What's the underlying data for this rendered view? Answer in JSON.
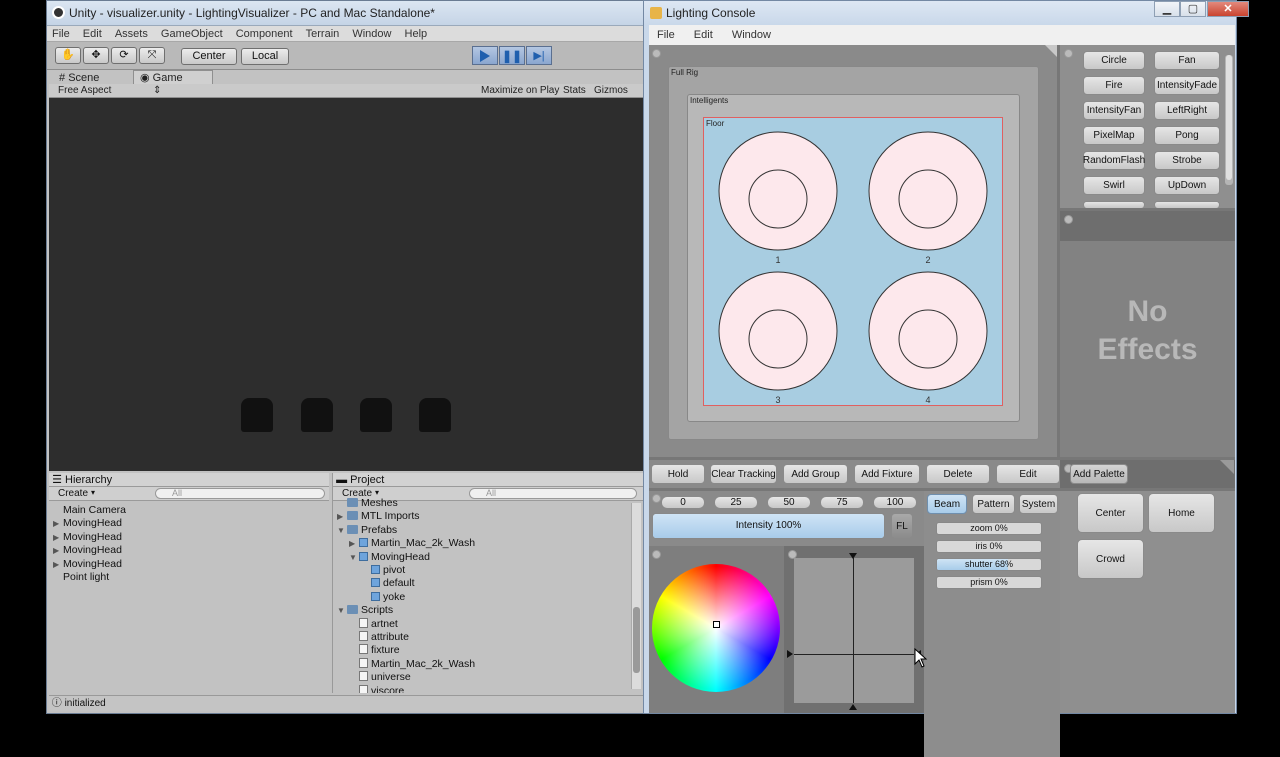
{
  "unity": {
    "window_title": "Unity - visualizer.unity - LightingVisualizer - PC and Mac Standalone*",
    "menu": [
      "File",
      "Edit",
      "Assets",
      "GameObject",
      "Component",
      "Terrain",
      "Window",
      "Help"
    ],
    "pivot_center": "Center",
    "pivot_local": "Local",
    "tabs": {
      "scene": "Scene",
      "game": "Game"
    },
    "gamebar": {
      "aspect": "Free Aspect",
      "maximize": "Maximize on Play",
      "stats": "Stats",
      "gizmos": "Gizmos"
    },
    "hierarchy": {
      "title": "Hierarchy",
      "create": "Create",
      "search_placeholder": "All",
      "items": [
        "Main Camera",
        "MovingHead",
        "MovingHead",
        "MovingHead",
        "MovingHead",
        "Point light"
      ]
    },
    "project": {
      "title": "Project",
      "create": "Create",
      "search_placeholder": "All",
      "items": [
        "Meshes",
        "MTL Imports",
        "Prefabs",
        "Martin_Mac_2k_Wash",
        "MovingHead",
        "pivot",
        "default",
        "yoke",
        "Scripts",
        "artnet",
        "attribute",
        "fixture",
        "Martin_Mac_2k_Wash",
        "universe",
        "viscore"
      ]
    },
    "status": "initialized"
  },
  "console": {
    "window_title": "Lighting Console",
    "menu": [
      "File",
      "Edit",
      "Window"
    ],
    "groups": {
      "full_rig": "Full Rig",
      "intelligents": "Intelligents",
      "floor": "Floor"
    },
    "fixtures": [
      "1",
      "2",
      "3",
      "4"
    ],
    "effects": [
      "Circle",
      "Fan",
      "Fire",
      "IntensityFade",
      "IntensityFan",
      "LeftRight",
      "PixelMap",
      "Pong",
      "RandomFlash",
      "Strobe",
      "Swirl",
      "UpDown"
    ],
    "no_effects_line1": "No",
    "no_effects_line2": "Effects",
    "actions": [
      "Hold",
      "Clear Tracking",
      "Add Group",
      "Add Fixture",
      "Delete",
      "Edit"
    ],
    "add_palette": "Add Palette",
    "intensity_presets": [
      "0",
      "25",
      "50",
      "75",
      "100"
    ],
    "intensity_label": "Intensity 100%",
    "intensity_level": 1.0,
    "fl": "FL",
    "attr_tabs": [
      "Beam",
      "Pattern",
      "System"
    ],
    "beam_attrs": [
      {
        "label": "zoom 0%",
        "level": 0
      },
      {
        "label": "iris 0%",
        "level": 0
      },
      {
        "label": "shutter 68%",
        "level": 0.68
      },
      {
        "label": "prism 0%",
        "level": 0
      }
    ],
    "palettes": [
      "Center",
      "Home",
      "Crowd"
    ]
  },
  "colors": {
    "accent_blue": "#a8cde1",
    "fixture_fill": "#fde8ec",
    "floor_border": "#e06060"
  }
}
